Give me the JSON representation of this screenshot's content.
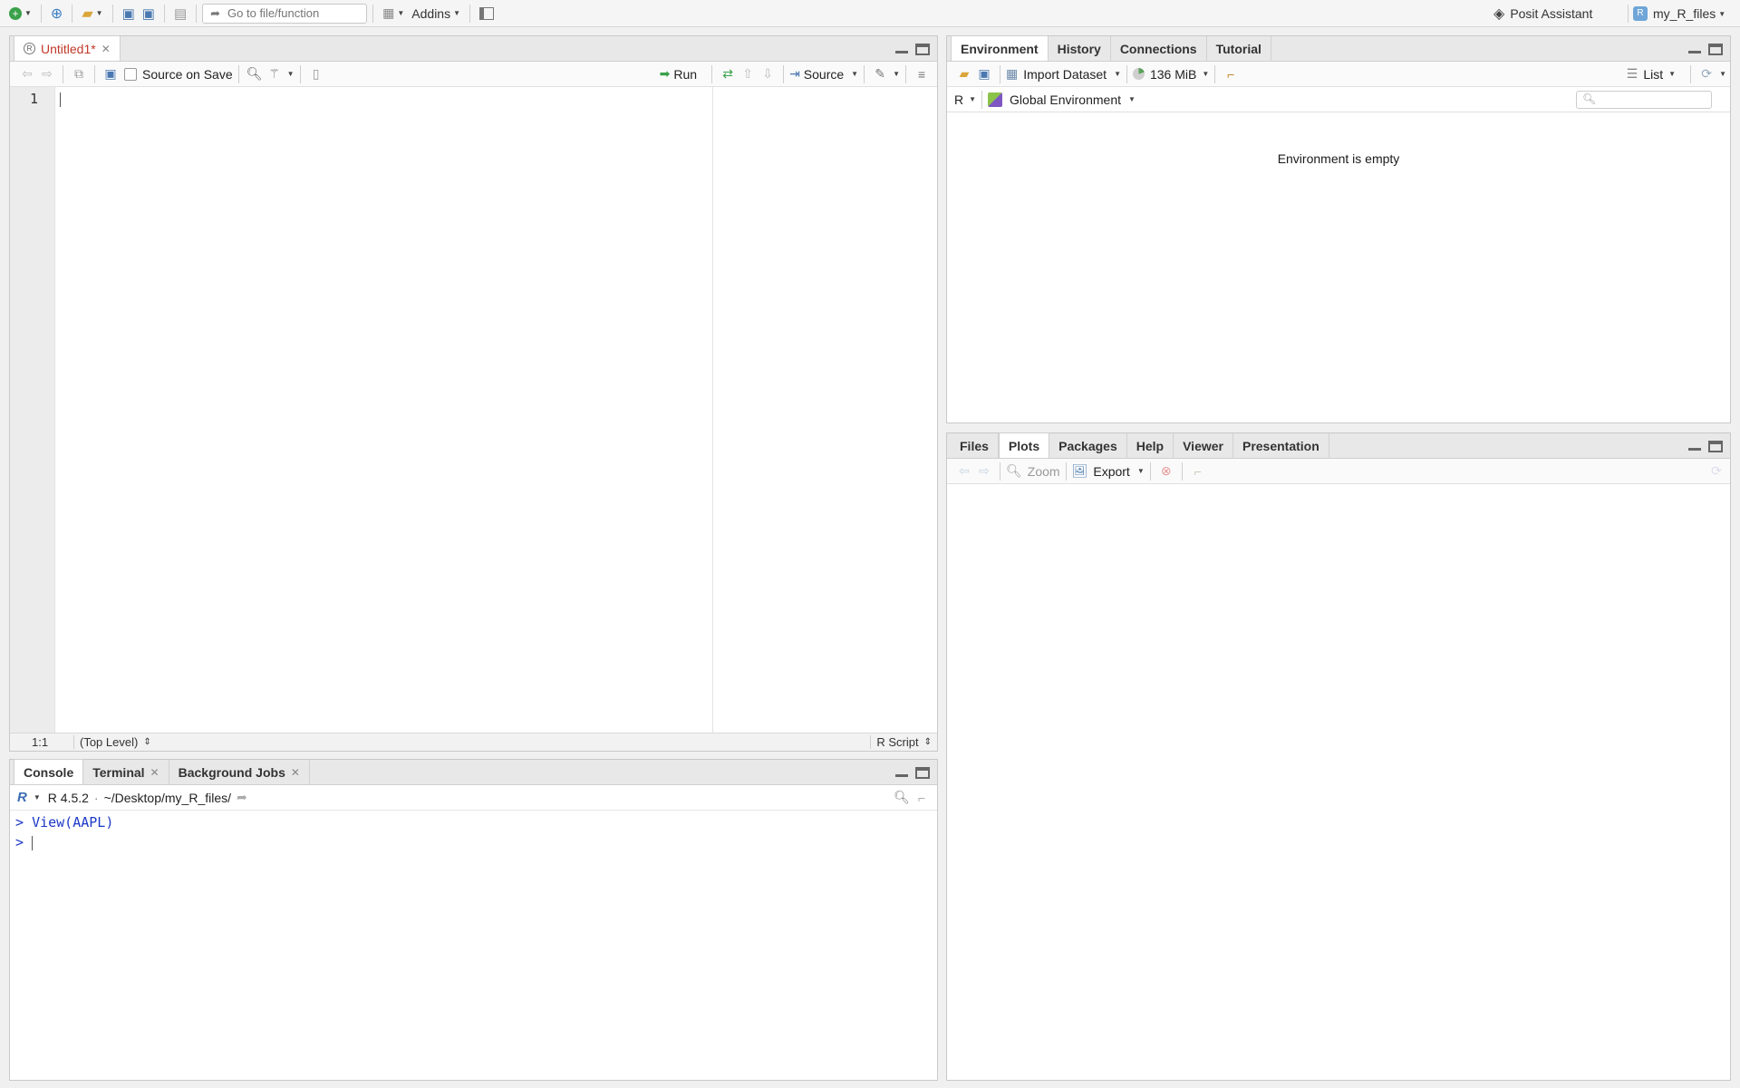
{
  "toolbar": {
    "goto_placeholder": "Go to file/function",
    "addins_label": "Addins",
    "assistant_label": "Posit Assistant",
    "project_label": "my_R_files"
  },
  "source_pane": {
    "tab_label": "Untitled1*",
    "source_on_save_label": "Source on Save",
    "run_label": "Run",
    "source_label": "Source",
    "line_number": "1",
    "cursor_pos": "1:1",
    "scope_label": "(Top Level)",
    "file_type": "R Script"
  },
  "console_pane": {
    "tabs": [
      "Console",
      "Terminal",
      "Background Jobs"
    ],
    "r_version": "R 4.5.2",
    "working_dir": "~/Desktop/my_R_files/",
    "lines": [
      "View(AAPL)",
      ""
    ],
    "prompt": ">"
  },
  "env_pane": {
    "tabs": [
      "Environment",
      "History",
      "Connections",
      "Tutorial"
    ],
    "import_label": "Import Dataset",
    "memory_label": "136 MiB",
    "list_label": "List",
    "language_label": "R",
    "scope_label": "Global Environment",
    "empty_message": "Environment is empty"
  },
  "files_pane": {
    "tabs": [
      "Files",
      "Plots",
      "Packages",
      "Help",
      "Viewer",
      "Presentation"
    ],
    "active_tab": "Plots",
    "zoom_label": "Zoom",
    "export_label": "Export"
  },
  "colors": {
    "accent_tab_text": "#c0392b",
    "prompt": "#1d38c6"
  }
}
